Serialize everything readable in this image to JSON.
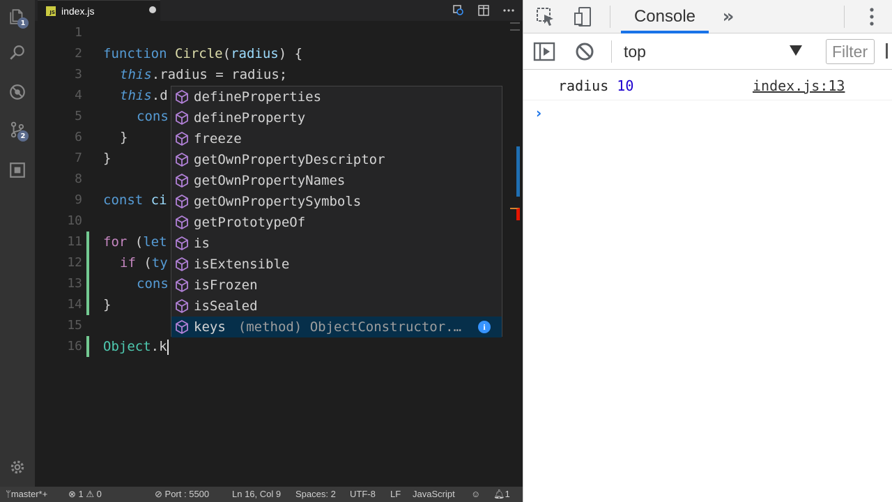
{
  "editor": {
    "tab": {
      "label": "index.js",
      "badge": "JS"
    },
    "lines": [
      {
        "num": "1"
      },
      {
        "num": "2"
      },
      {
        "num": "3"
      },
      {
        "num": "4"
      },
      {
        "num": "5"
      },
      {
        "num": "6"
      },
      {
        "num": "7"
      },
      {
        "num": "8"
      },
      {
        "num": "9"
      },
      {
        "num": "10"
      },
      {
        "num": "11"
      },
      {
        "num": "12"
      },
      {
        "num": "13"
      },
      {
        "num": "14"
      },
      {
        "num": "15"
      },
      {
        "num": "16"
      }
    ],
    "code": {
      "l2_kw": "function",
      "l2_fn": "Circle",
      "l2_open": "(",
      "l2_param": "radius",
      "l2_close": ") {",
      "l3_this": "this",
      "l3_rest": ".radius = radius;",
      "l4_this": "this",
      "l4_rest": ".d",
      "l5": "cons",
      "l6": "}",
      "l7": "}",
      "l9_kw": "const",
      "l9_rest": " ci",
      "l11_kw": "for",
      "l11_open": " (",
      "l11_let": "let",
      "l12_kw": "if",
      "l12_open": " (",
      "l12_rest": "ty",
      "l13": "cons",
      "l14": "}",
      "l16_obj": "Object",
      "l16_rest": ".k"
    },
    "badges": {
      "explorer": "1",
      "scm": "2"
    }
  },
  "suggestions": {
    "items": [
      {
        "label": "defineProperties"
      },
      {
        "label": "defineProperty"
      },
      {
        "label": "freeze"
      },
      {
        "label": "getOwnPropertyDescriptor"
      },
      {
        "label": "getOwnPropertyNames"
      },
      {
        "label": "getOwnPropertySymbols"
      },
      {
        "label": "getPrototypeOf"
      },
      {
        "label": "is"
      },
      {
        "label": "isExtensible"
      },
      {
        "label": "isFrozen"
      },
      {
        "label": "isSealed"
      },
      {
        "label": "keys",
        "detail": "(method) ObjectConstructor.…"
      }
    ],
    "info_glyph": "i",
    "icon_color": "#b180d7"
  },
  "status_bar": {
    "branch": "master*+",
    "errors": "1",
    "warnings": "0",
    "port": "Port : 5500",
    "position": "Ln 16, Col 9",
    "spaces": "Spaces: 2",
    "encoding": "UTF-8",
    "eol": "LF",
    "language": "JavaScript",
    "notifications": "1"
  },
  "devtools": {
    "tab_label": "Console",
    "more_tabs": "»",
    "context": "top",
    "filter_placeholder": "Filter",
    "log": {
      "key": "radius",
      "value": "10",
      "source": "index.js:13"
    },
    "prompt": "›",
    "accent": "#1a73e8"
  }
}
